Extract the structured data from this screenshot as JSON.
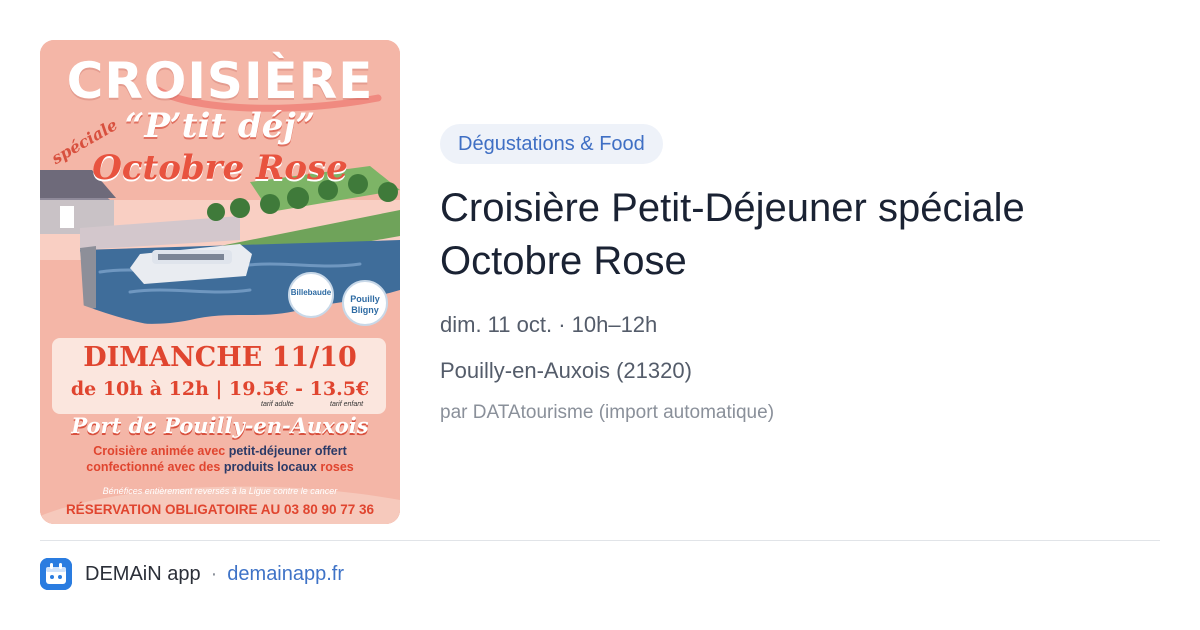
{
  "event": {
    "category": "Dégustations & Food",
    "title": "Croisière Petit-Déjeuner spéciale Octobre Rose",
    "datetime": "dim. 11 oct. · 10h–12h",
    "location": "Pouilly-en-Auxois (21320)",
    "source": "par DATAtourisme (import automatique)"
  },
  "poster": {
    "title": "CROISIÈRE",
    "subtitle_prefix": "spéciale",
    "subtitle_quote": "“P’tit déj”",
    "subtitle_main": "Octobre Rose",
    "date_line": "DIMANCHE 11/10",
    "hours_line": "de 10h à 12h | 19.5€ - 13.5€",
    "tarif_adult": "tarif adulte",
    "tarif_child": "tarif enfant",
    "port": "Port de Pouilly-en-Auxois",
    "desc_line1_a": "Croisière animée avec ",
    "desc_line1_b": "petit-déjeuner offert",
    "desc_line2_a": "confectionné avec des ",
    "desc_line2_b": "produits locaux",
    "desc_line2_c": " roses",
    "benefits": "Bénéfices entièrement reversés à la Ligue contre le cancer",
    "reservation": "RÉSERVATION OBLIGATOIRE AU 03 80 90 77 36",
    "logo1": "Billebaude",
    "logo2_a": "Pouilly",
    "logo2_b": "Bligny"
  },
  "footer": {
    "app_name": "DEMAiN app",
    "separator": "·",
    "link": "demainapp.fr"
  },
  "colors": {
    "chip_bg": "#eef2f9",
    "chip_text": "#3f6fc4",
    "link": "#3f73c7",
    "app_icon": "#2a7ce0",
    "poster_bg": "#f4b6a7",
    "poster_accent": "#e0452f"
  },
  "icons": {
    "app": "demain-app-icon",
    "ribbon": "pink-ribbon-icon"
  }
}
